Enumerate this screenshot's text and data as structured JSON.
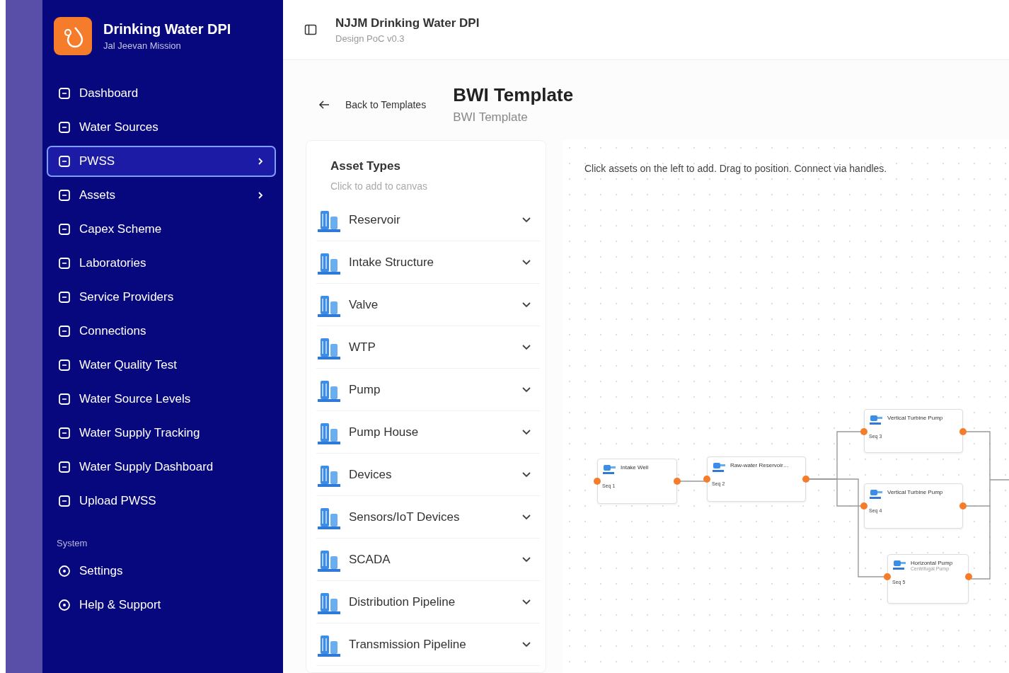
{
  "sidebar": {
    "brand": {
      "title": "Drinking Water DPI",
      "subtitle": "Jal Jeevan Mission"
    },
    "items": [
      {
        "label": "Dashboard",
        "selected": false,
        "has_submenu": false
      },
      {
        "label": "Water Sources",
        "selected": false,
        "has_submenu": false
      },
      {
        "label": "PWSS",
        "selected": true,
        "has_submenu": true
      },
      {
        "label": "Assets",
        "selected": false,
        "has_submenu": true
      },
      {
        "label": "Capex Scheme",
        "selected": false,
        "has_submenu": false
      },
      {
        "label": "Laboratories",
        "selected": false,
        "has_submenu": false
      },
      {
        "label": "Service Providers",
        "selected": false,
        "has_submenu": false
      },
      {
        "label": "Connections",
        "selected": false,
        "has_submenu": false
      },
      {
        "label": "Water Quality Test",
        "selected": false,
        "has_submenu": false
      },
      {
        "label": "Water Source Levels",
        "selected": false,
        "has_submenu": false
      },
      {
        "label": "Water Supply Tracking",
        "selected": false,
        "has_submenu": false
      },
      {
        "label": "Water Supply Dashboard",
        "selected": false,
        "has_submenu": false
      },
      {
        "label": "Upload PWSS",
        "selected": false,
        "has_submenu": false
      }
    ],
    "section_label": "System",
    "system_items": [
      {
        "label": "Settings",
        "selected": false,
        "has_submenu": false
      },
      {
        "label": "Help & Support",
        "selected": false,
        "has_submenu": false
      }
    ]
  },
  "header": {
    "title": "NJJM Drinking Water DPI",
    "subtitle": "Design PoC v0.3"
  },
  "page": {
    "back_link": "Back to Templates",
    "title": "BWI Template",
    "subtitle": "BWI Template"
  },
  "asset_panel": {
    "title": "Asset Types",
    "hint": "Click to add to canvas",
    "items": [
      {
        "label": "Reservoir",
        "expanded": false
      },
      {
        "label": "Intake Structure",
        "expanded": false
      },
      {
        "label": "Valve",
        "expanded": false
      },
      {
        "label": "WTP",
        "expanded": false
      },
      {
        "label": "Pump",
        "expanded": false
      },
      {
        "label": "Pump House",
        "expanded": false
      },
      {
        "label": "Devices",
        "expanded": false
      },
      {
        "label": "Sensors/IoT Devices",
        "expanded": false
      },
      {
        "label": "SCADA",
        "expanded": false
      },
      {
        "label": "Distribution Pipeline",
        "expanded": false
      },
      {
        "label": "Transmission Pipeline",
        "expanded": false
      }
    ]
  },
  "canvas": {
    "hint": "Click assets on the left to add. Drag to position. Connect via handles.",
    "nodes": [
      {
        "name": "Intake Well",
        "seq": "Seq 1"
      },
      {
        "name": "Raw-water Reservoir…",
        "seq": "Seq 2"
      },
      {
        "name": "Vertical Turbine Pump",
        "seq": "Seq 3"
      },
      {
        "name": "Vertical Turbine Pump",
        "seq": "Seq 4"
      },
      {
        "name": "Horizontal Pump",
        "subtitle": "Centrifugal Pump",
        "seq": "Seq 5"
      }
    ]
  }
}
